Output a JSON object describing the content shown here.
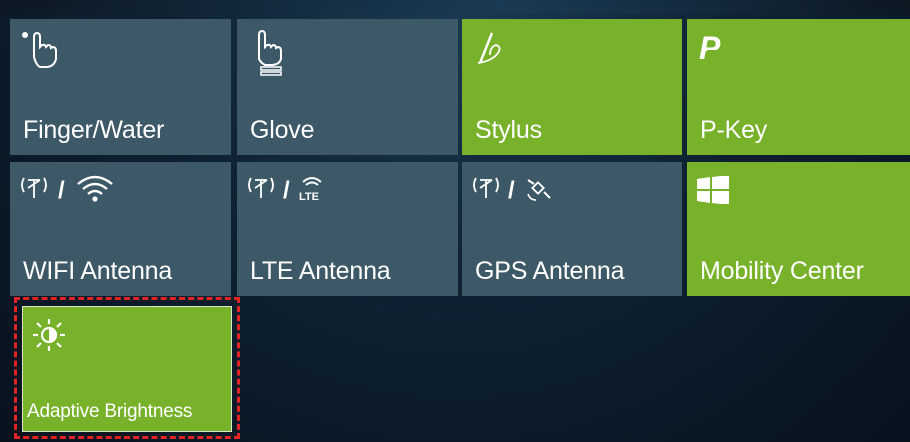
{
  "tiles": [
    {
      "label": "Finger/Water",
      "state": "off",
      "icon": "finger-water-icon"
    },
    {
      "label": "Glove",
      "state": "off",
      "icon": "glove-icon"
    },
    {
      "label": "Stylus",
      "state": "on",
      "icon": "stylus-icon"
    },
    {
      "label": "P-Key",
      "state": "on",
      "icon": "p-key-icon"
    },
    {
      "label": "WIFI Antenna",
      "state": "off",
      "icon": "wifi-antenna-icon",
      "separator": "/"
    },
    {
      "label": "LTE Antenna",
      "state": "off",
      "icon": "lte-antenna-icon",
      "separator": "/"
    },
    {
      "label": "GPS Antenna",
      "state": "off",
      "icon": "gps-antenna-icon",
      "separator": "/"
    },
    {
      "label": "Mobility Center",
      "state": "on",
      "icon": "windows-icon"
    },
    {
      "label": "Adaptive Brightness",
      "state": "on",
      "icon": "brightness-icon",
      "selected": true
    }
  ],
  "colors": {
    "tile_on": "#78b12a",
    "tile_off": "#3d5866",
    "selection": "#e22424"
  }
}
